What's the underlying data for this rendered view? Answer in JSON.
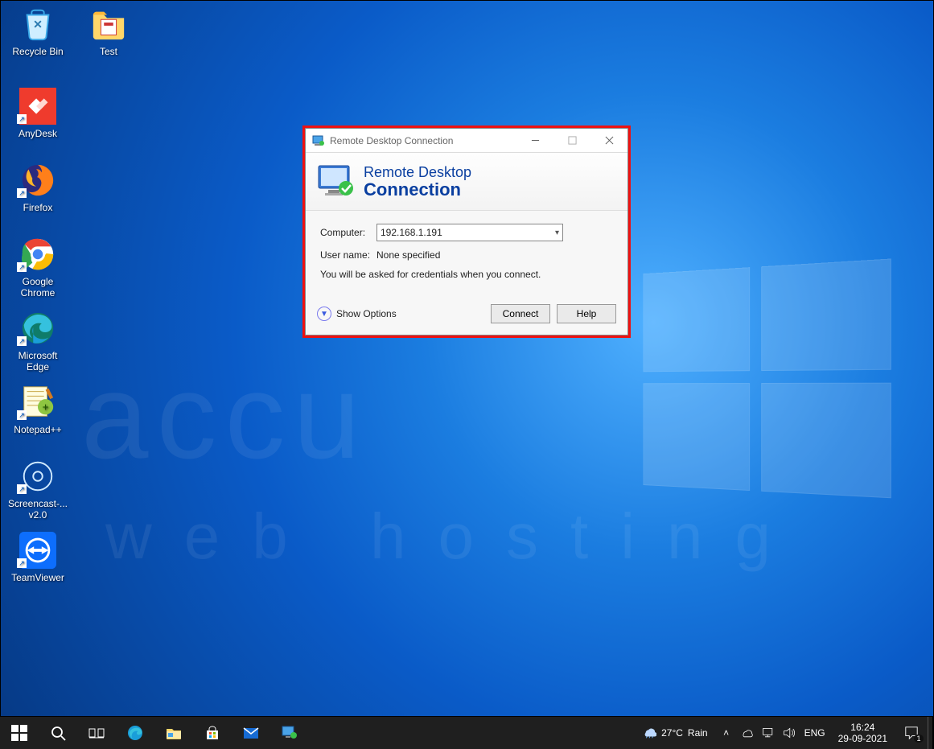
{
  "desktop_icons_col1": [
    {
      "name": "recycle-bin",
      "label": "Recycle Bin",
      "shortcut": false
    },
    {
      "name": "anydesk",
      "label": "AnyDesk",
      "shortcut": true
    },
    {
      "name": "firefox",
      "label": "Firefox",
      "shortcut": true
    },
    {
      "name": "chrome",
      "label": "Google Chrome",
      "shortcut": true
    },
    {
      "name": "edge",
      "label": "Microsoft Edge",
      "shortcut": true
    },
    {
      "name": "notepadpp",
      "label": "Notepad++",
      "shortcut": true
    },
    {
      "name": "screencast",
      "label": "Screencast-... v2.0",
      "shortcut": true
    },
    {
      "name": "teamviewer",
      "label": "TeamViewer",
      "shortcut": true
    }
  ],
  "desktop_icons_col2": [
    {
      "name": "test-folder",
      "label": "Test",
      "shortcut": false
    }
  ],
  "watermark_top": "accu",
  "watermark_bottom": "web hosting",
  "rdp": {
    "title": "Remote Desktop Connection",
    "banner_l1": "Remote Desktop",
    "banner_l2": "Connection",
    "computer_label": "Computer:",
    "computer_value": "192.168.1.191",
    "username_label": "User name:",
    "username_value": "None specified",
    "info": "You will be asked for credentials when you connect.",
    "show_options": "Show Options",
    "connect": "Connect",
    "help": "Help"
  },
  "taskbar": {
    "weather_temp": "27°C",
    "weather_desc": "Rain",
    "lang": "ENG",
    "time": "16:24",
    "date": "29-09-2021",
    "notif_count": "1"
  }
}
